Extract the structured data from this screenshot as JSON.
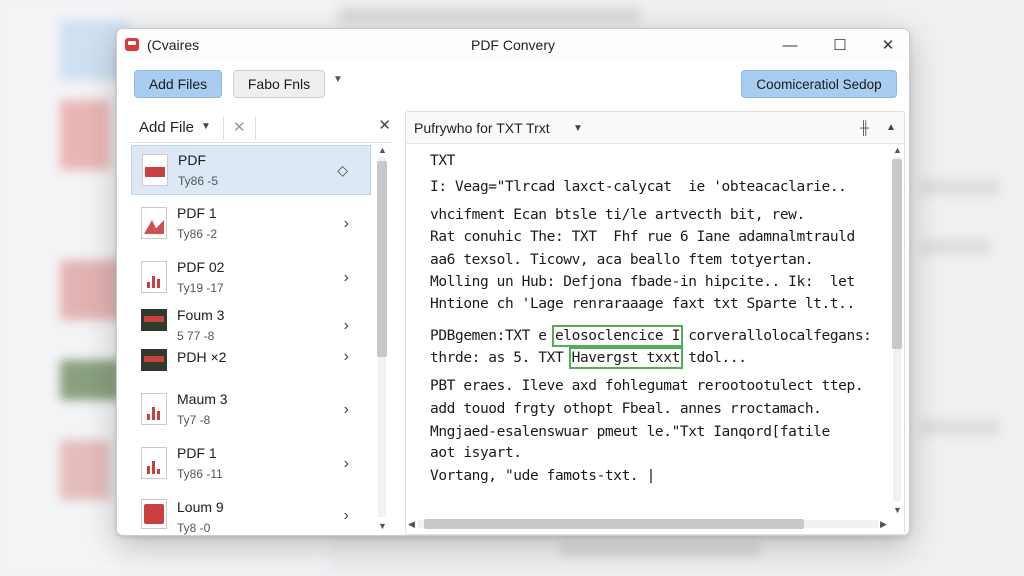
{
  "window": {
    "app_name": "(Cvaires",
    "title": "PDF Convery",
    "controls": {
      "minimize": "—",
      "maximize": "☐",
      "close": "✕"
    }
  },
  "toolbar": {
    "add_files_label": "Add Files",
    "secondary_label": "Fabo Fnls",
    "right_button_label": "Coomiceratiol Sedop"
  },
  "left_panel": {
    "header_label": "Add File",
    "files": [
      {
        "name": "PDF",
        "sub": "Ty86 -5",
        "selected": true,
        "icon": "pdf-file-icon",
        "chevron": "◇"
      },
      {
        "name": "PDF    1",
        "sub": "Ty86 -2",
        "selected": false,
        "icon": "pdf-file-icon",
        "chevron": "›"
      },
      {
        "name": "PDF 02",
        "sub": "Ty19 -17",
        "selected": false,
        "icon": "chart-file-icon",
        "chevron": "›"
      },
      {
        "name": "Foum 3",
        "sub": "5 77 -8",
        "selected": false,
        "icon": "image-file-icon",
        "chevron": "›"
      },
      {
        "name": "PDH ×2",
        "sub": "",
        "selected": false,
        "icon": "image-file-icon",
        "chevron": "›"
      },
      {
        "name": "Maum 3",
        "sub": "Ty7 -8",
        "selected": false,
        "icon": "chart-file-icon",
        "chevron": "›"
      },
      {
        "name": "PDF    1",
        "sub": "Ty86 -11",
        "selected": false,
        "icon": "chart-file-icon",
        "chevron": "›"
      },
      {
        "name": "Loum 9",
        "sub": "Ty8 -0",
        "selected": false,
        "icon": "doc-file-icon",
        "chevron": "›"
      }
    ]
  },
  "right_panel": {
    "header_label": "Pufrywho for TXT Trxt",
    "lines": [
      "TXT",
      "I: Veag=\"Tlrcad laxct-calycat  ie 'obteacaclarie..",
      "vhcifment Ecan btsle ti/le artvecth bit, rew.",
      "Rat conuhic The: TXT  Fhf rue 6 Iane adamnalmtrauld",
      "aa6 texsol. Ticowv, aca beallo ftem totyertan.",
      "Molling un Hub: Defjona fbade-in hipcite.. Ik:  let",
      "Hntione ch 'Lage renraraaage faxt txt Sparte lt.t..",
      "PDBgemen:TXT e ",
      "thrde: as 5. TXT ",
      "PBT eraes. Ileve axd fohlegumat rerootootulect ttep.",
      "add touod frgty othopt Fbeal. annes rroctamach.",
      "Mngjaed-esalenswuar pmeut le.\"Txt Ianqord[fatile",
      "aot isyart.",
      "Vortang, \"ude famots-txt. |"
    ],
    "highlight_line1": "elosoclencice I",
    "after_highlight1": " corverallolocalfegans:",
    "highlight_line2": "Havergst txxt",
    "after_highlight2": " tdol..."
  },
  "colors": {
    "accent_button": "#a9cdf0",
    "selected_row": "#dce8f6",
    "pdf_red": "#c94040",
    "highlight_border": "#4fae57"
  }
}
